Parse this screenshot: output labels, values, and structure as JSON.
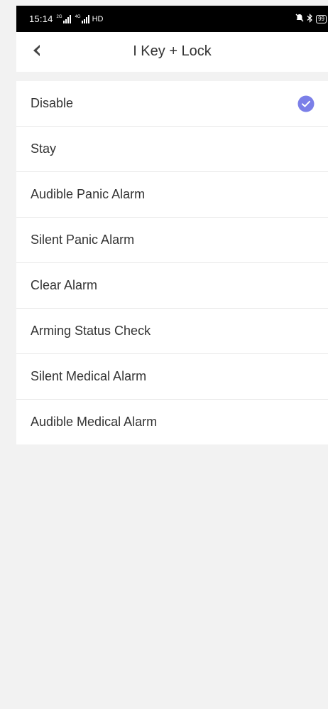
{
  "status_bar": {
    "time": "15:14",
    "signal1_label": "2G",
    "signal2_label": "4G",
    "network_type": "HD",
    "battery": "99"
  },
  "header": {
    "title": "I Key + Lock",
    "back_icon": "chevron-left-icon"
  },
  "options": [
    {
      "label": "Disable",
      "selected": true
    },
    {
      "label": "Stay",
      "selected": false
    },
    {
      "label": "Audible Panic Alarm",
      "selected": false
    },
    {
      "label": "Silent Panic Alarm",
      "selected": false
    },
    {
      "label": "Clear Alarm",
      "selected": false
    },
    {
      "label": "Arming Status Check",
      "selected": false
    },
    {
      "label": "Silent Medical Alarm",
      "selected": false
    },
    {
      "label": "Audible Medical Alarm",
      "selected": false
    }
  ],
  "colors": {
    "accent": "#7b7fe8",
    "background": "#f2f2f2",
    "text": "#333333"
  }
}
